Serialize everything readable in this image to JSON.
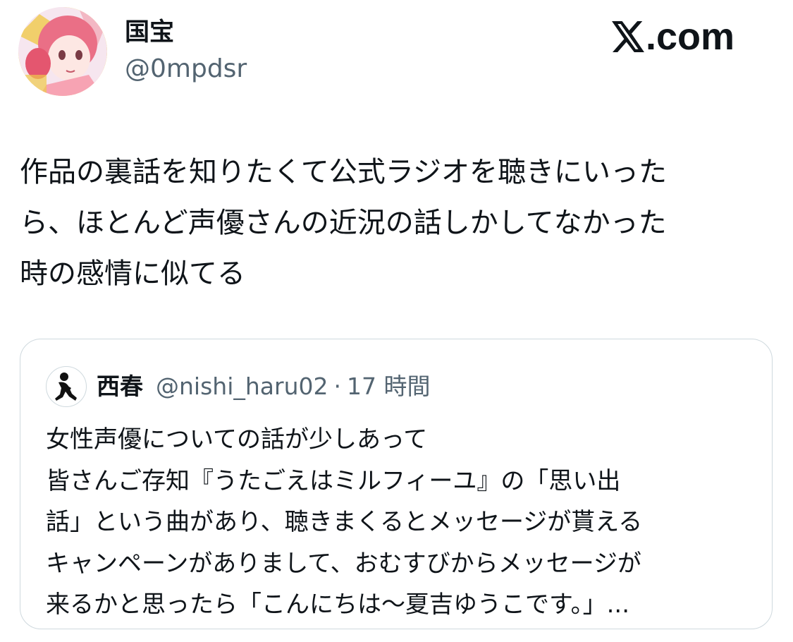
{
  "author": {
    "display_name": "国宝",
    "handle": "@0mpdsr",
    "avatar_icon": "anime-girl-avatar"
  },
  "brand": {
    "logo_icon": "x-logo-icon",
    "domain_text": ".com"
  },
  "tweet": {
    "lines": [
      "作品の裏話を知りたくて公式ラジオを聴きにいった",
      "ら、ほとんど声優さんの近況の話しかしてなかった",
      "時の感情に似てる"
    ]
  },
  "quote": {
    "avatar_icon": "sitting-person-avatar",
    "display_name": "西春",
    "handle": "@nishi_haru02",
    "separator": "·",
    "time": "17 時間",
    "lines": [
      "女性声優についての話が少しあって",
      "皆さんご存知『うたごえはミルフィーユ』の「思い出",
      "話」という曲があり、聴きまくるとメッセージが貰える",
      "キャンペーンがありまして、おむすびからメッセージが",
      "来るかと思ったら「こんにちは〜夏吉ゆうこです。」..."
    ]
  },
  "colors": {
    "text_primary": "#0f1419",
    "text_secondary": "#536471",
    "border": "#cfd9de"
  }
}
